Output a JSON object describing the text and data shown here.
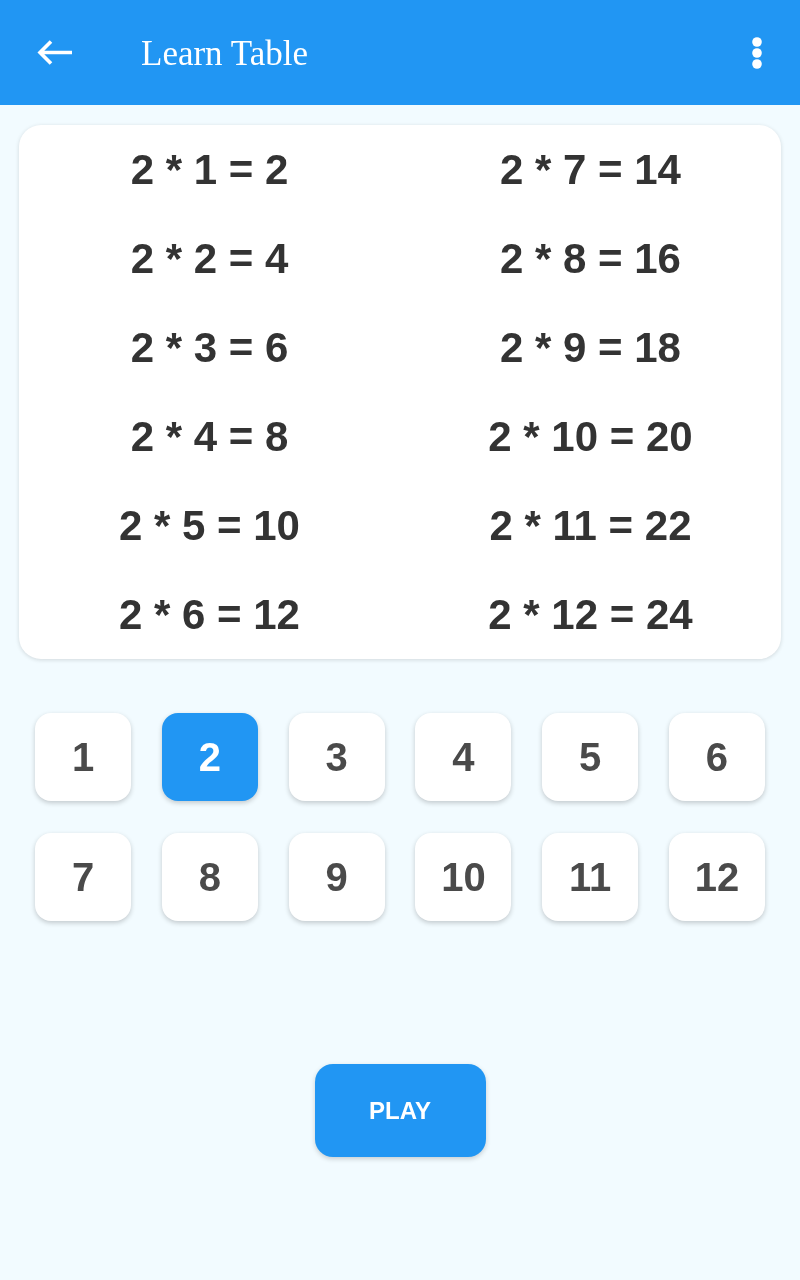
{
  "app_bar": {
    "title": "Learn Table"
  },
  "table": {
    "columns": [
      {
        "entries": [
          "2 * 1 = 2",
          "2 * 2 = 4",
          "2 * 3 = 6",
          "2 * 4 = 8",
          "2 * 5 = 10",
          "2 * 6 = 12"
        ]
      },
      {
        "entries": [
          "2 * 7 = 14",
          "2 * 8 = 16",
          "2 * 9 = 18",
          "2 * 10 = 20",
          "2 * 11 = 22",
          "2 * 12 = 24"
        ]
      }
    ]
  },
  "numbers": [
    {
      "label": "1",
      "selected": false
    },
    {
      "label": "2",
      "selected": true
    },
    {
      "label": "3",
      "selected": false
    },
    {
      "label": "4",
      "selected": false
    },
    {
      "label": "5",
      "selected": false
    },
    {
      "label": "6",
      "selected": false
    },
    {
      "label": "7",
      "selected": false
    },
    {
      "label": "8",
      "selected": false
    },
    {
      "label": "9",
      "selected": false
    },
    {
      "label": "10",
      "selected": false
    },
    {
      "label": "11",
      "selected": false
    },
    {
      "label": "12",
      "selected": false
    }
  ],
  "play_button": {
    "label": "PLAY"
  }
}
